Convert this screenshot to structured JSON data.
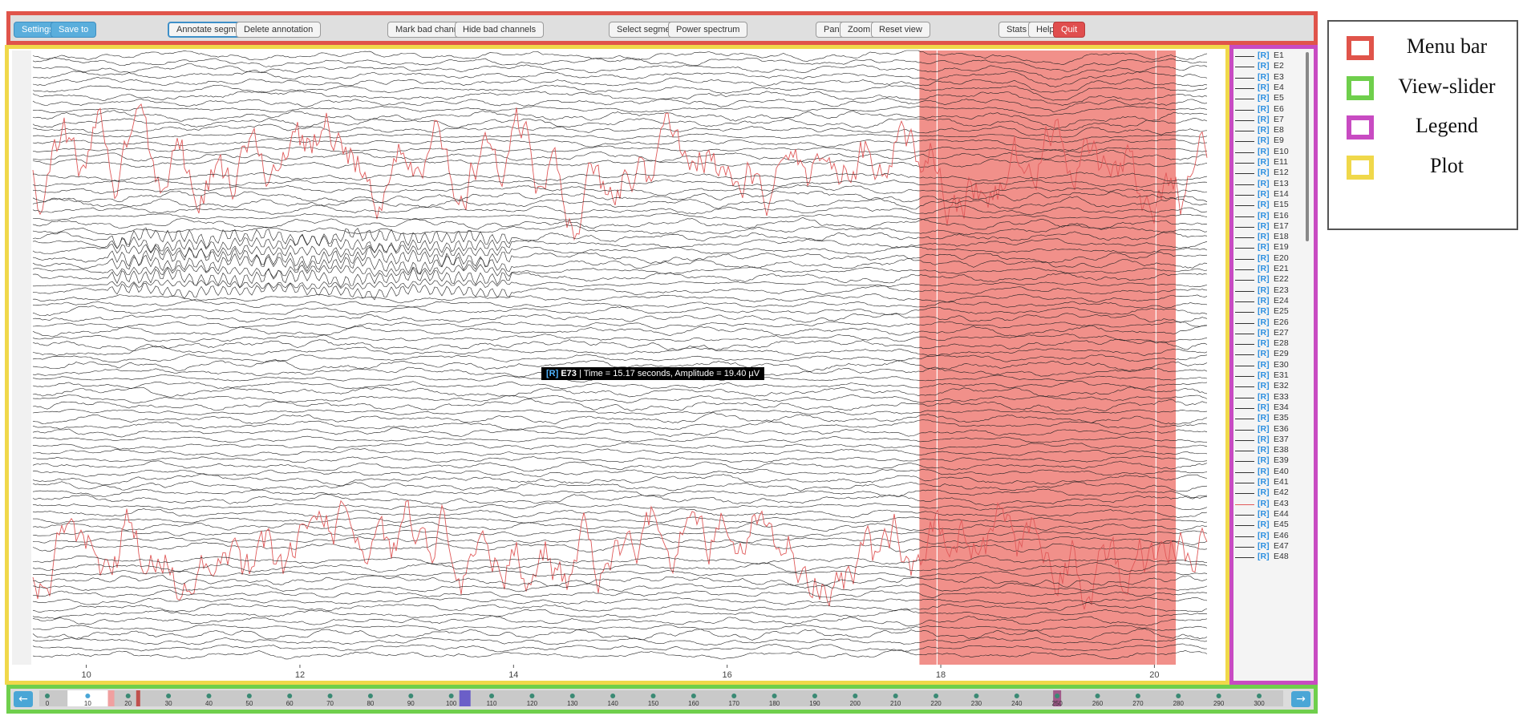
{
  "menu": {
    "settings": "Settings",
    "save_to": "Save to",
    "annotate_segment": "Annotate segment",
    "delete_annotation": "Delete annotation",
    "mark_bad_channels": "Mark bad channels",
    "hide_bad_channels": "Hide bad channels",
    "select_segment": "Select segment",
    "power_spectrum": "Power spectrum",
    "pan": "Pan",
    "zoom": "Zoom",
    "reset_view": "Reset view",
    "stats": "Stats",
    "help": "Help",
    "quit": "Quit"
  },
  "plot": {
    "x_ticks": [
      "10",
      "12",
      "14",
      "16",
      "18",
      "20"
    ],
    "x_tick_values": [
      10,
      12,
      14,
      16,
      18,
      20
    ],
    "x_range": [
      9.5,
      20.5
    ],
    "annotation_span": [
      17.8,
      20.2
    ],
    "bad_channel_indices": [
      17,
      74
    ],
    "tooltip": {
      "badge": "[R]",
      "channel": "E73",
      "text": "| Time = 15.17 seconds, Amplitude = 19.40 µV"
    }
  },
  "legend": {
    "prefix": "[R]",
    "channels": [
      "E1",
      "E2",
      "E3",
      "E4",
      "E5",
      "E6",
      "E7",
      "E8",
      "E9",
      "E10",
      "E11",
      "E12",
      "E13",
      "E14",
      "E15",
      "E16",
      "E17",
      "E18",
      "E19",
      "E20",
      "E21",
      "E22",
      "E23",
      "E24",
      "E25",
      "E26",
      "E27",
      "E28",
      "E29",
      "E30",
      "E31",
      "E32",
      "E33",
      "E34",
      "E35",
      "E36",
      "E37",
      "E38",
      "E39",
      "E40",
      "E41",
      "E42",
      "E43",
      "E44",
      "E45",
      "E46",
      "E47",
      "E48"
    ],
    "bad_channels": [
      "E43"
    ]
  },
  "slider": {
    "ticks": [
      "0",
      "10",
      "20",
      "30",
      "40",
      "50",
      "60",
      "70",
      "80",
      "90",
      "100",
      "110",
      "120",
      "130",
      "140",
      "150",
      "160",
      "170",
      "180",
      "190",
      "200",
      "210",
      "220",
      "230",
      "240",
      "250",
      "260",
      "270",
      "280",
      "290",
      "300"
    ],
    "range": [
      0,
      300
    ],
    "view_window": [
      5,
      15
    ]
  },
  "key": {
    "items": [
      {
        "label": "Menu bar",
        "color": "#e0544a"
      },
      {
        "label": "View-slider",
        "color": "#6fcf4c"
      },
      {
        "label": "Legend",
        "color": "#c84bc2"
      },
      {
        "label": "Plot",
        "color": "#f0d84a"
      }
    ]
  },
  "colors": {
    "trace": "#222222",
    "bad_trace": "#e05a5a",
    "annotation": "#ec6b63",
    "accent": "#4aa6d6"
  }
}
